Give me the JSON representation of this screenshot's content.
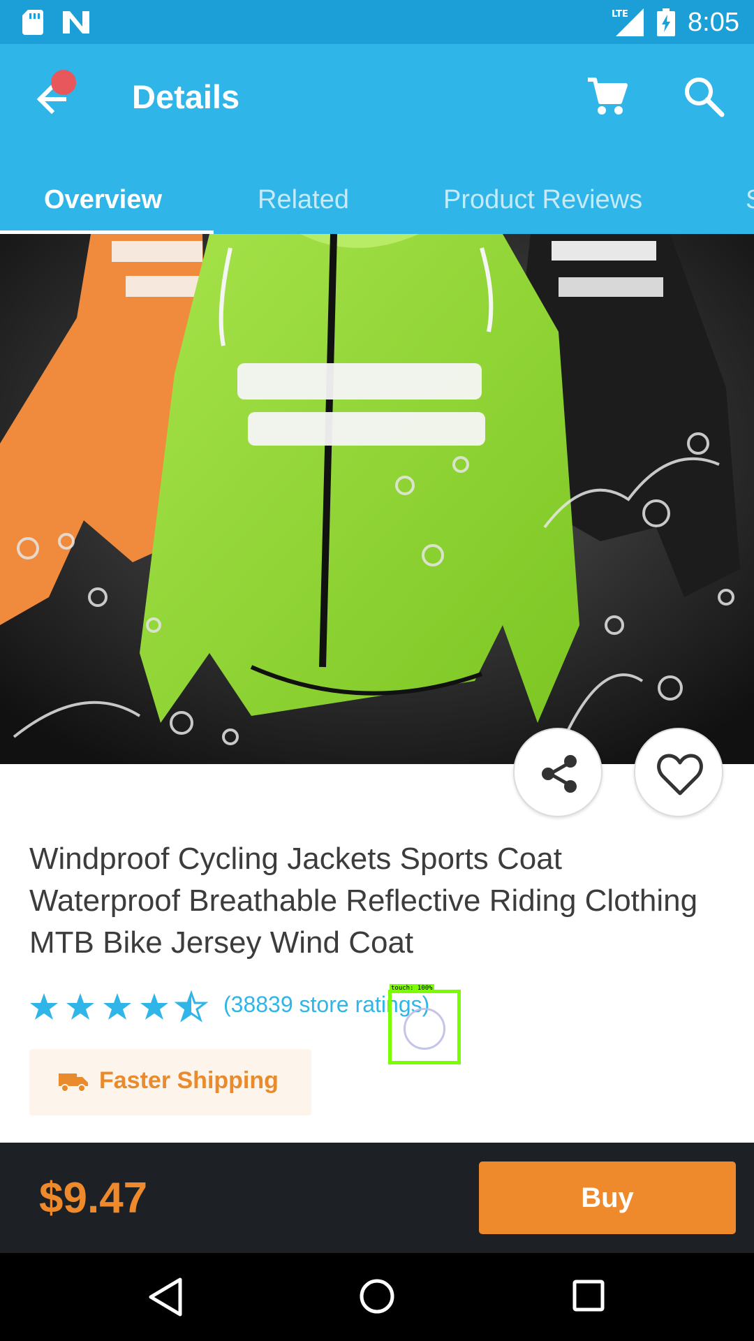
{
  "status_bar": {
    "time": "8:05",
    "network": "LTE",
    "icons": [
      "sd-card-icon",
      "n-notification-icon",
      "lte-signal-icon",
      "battery-charging-icon"
    ]
  },
  "app_bar": {
    "title": "Details",
    "back_icon": "arrow-back-icon",
    "cart_icon": "cart-icon",
    "search_icon": "search-icon",
    "notification_dot_color": "#e8575b",
    "background": "#2fb5e8"
  },
  "tabs": [
    {
      "label": "Overview",
      "active": true
    },
    {
      "label": "Related",
      "active": false
    },
    {
      "label": "Product Reviews",
      "active": false
    },
    {
      "label": "S",
      "active": false
    }
  ],
  "product": {
    "image_alt": "green reflective cycling jacket with water splash",
    "title": "Windproof Cycling Jackets Sports Coat Waterproof Breathable Reflective Riding Clothing MTB Bike Jersey Wind Coat",
    "rating": 4.5,
    "rating_count_text": "(38839 store ratings)",
    "shipping_label": "Faster Shipping",
    "share_icon": "share-icon",
    "wishlist_icon": "heart-outline-icon"
  },
  "overlay": {
    "touch_label": "touch: 100%"
  },
  "bottom_bar": {
    "price": "$9.47",
    "buy_label": "Buy",
    "accent": "#ef8a2c"
  },
  "nav_bar": {
    "icons": [
      "nav-back-icon",
      "nav-home-icon",
      "nav-recent-icon"
    ]
  }
}
